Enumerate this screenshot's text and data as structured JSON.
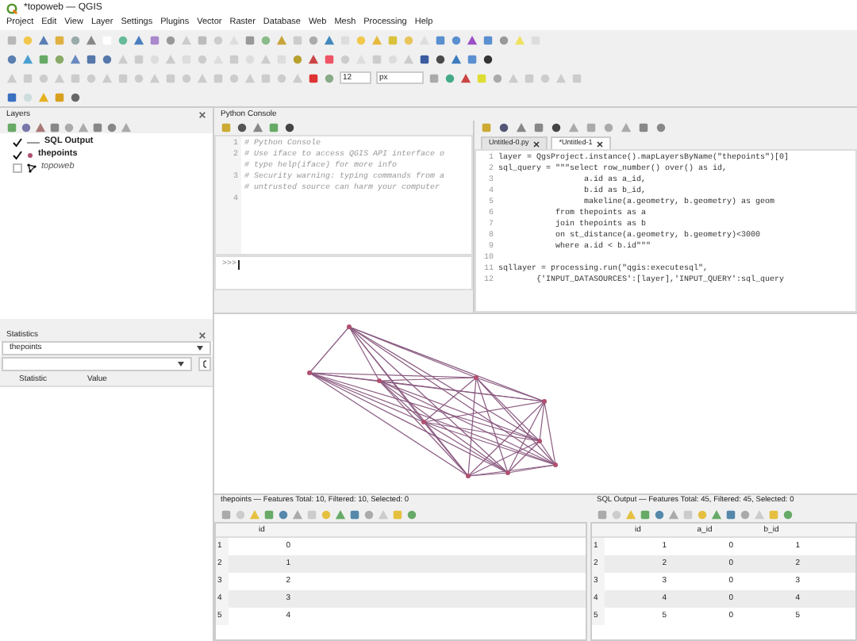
{
  "window": {
    "title": "*topoweb — QGIS"
  },
  "menu": [
    "Project",
    "Edit",
    "View",
    "Layer",
    "Settings",
    "Plugins",
    "Vector",
    "Raster",
    "Database",
    "Web",
    "Mesh",
    "Processing",
    "Help"
  ],
  "toolbar": {
    "font_size": "12",
    "unit": "px"
  },
  "layers_panel": {
    "title": "Layers",
    "items": [
      {
        "label": "SQL Output",
        "kind": "line",
        "checked": true
      },
      {
        "label": "thepoints",
        "kind": "point",
        "checked": true
      },
      {
        "label": "topoweb",
        "kind": "mesh",
        "checked": false
      }
    ]
  },
  "python_console": {
    "title": "Python Console",
    "lines": [
      {
        "number": "1",
        "text": "# Python Console"
      },
      {
        "number": "2",
        "text": "# Use iface to access QGIS API interface o"
      },
      {
        "text": "# type help(iface) for more info"
      },
      {
        "number": "3",
        "text": "# Security warning: typing commands from a"
      },
      {
        "text": "# untrusted source can harm your computer"
      },
      {
        "number": "4"
      }
    ],
    "prompt": ">>>",
    "editor_tabs": [
      {
        "label": "Untitled-0.py",
        "selected": false
      },
      {
        "label": "*Untitled-1",
        "selected": true
      }
    ],
    "code": [
      {
        "number": "1",
        "text": "layer = QgsProject.instance().mapLayersByName(\"thepoints\")[0]"
      },
      {
        "number": "2",
        "text": "sql_query = \"\"\"select row_number() over() as id,"
      },
      {
        "number": "3",
        "text": "                  a.id as a_id,"
      },
      {
        "number": "4",
        "text": "                  b.id as b_id,"
      },
      {
        "number": "5",
        "text": "                  makeline(a.geometry, b.geometry) as geom"
      },
      {
        "number": "6",
        "text": "            from thepoints as a"
      },
      {
        "number": "7",
        "text": "            join thepoints as b"
      },
      {
        "number": "8",
        "text": "            on st_distance(a.geometry, b.geometry)<3000"
      },
      {
        "number": "9",
        "text": "            where a.id < b.id\"\"\""
      },
      {
        "number": "10"
      },
      {
        "number": "11",
        "text": "sqllayer = processing.run(\"qgis:executesql\","
      },
      {
        "number": "12",
        "text": "        {'INPUT_DATASOURCES':[layer],'INPUT_QUERY':sql_query"
      }
    ]
  },
  "statistics_panel": {
    "title": "Statistics",
    "layer": "thepoints",
    "columns": [
      "Statistic",
      "Value"
    ]
  },
  "attribute_tables": [
    {
      "title": "thepoints — Features Total: 10, Filtered: 10, Selected: 0",
      "columns": [
        "id"
      ],
      "rows": [
        {
          "number": "1",
          "cells": [
            "0"
          ]
        },
        {
          "number": "2",
          "cells": [
            "1"
          ]
        },
        {
          "number": "3",
          "cells": [
            "2"
          ]
        },
        {
          "number": "4",
          "cells": [
            "3"
          ]
        },
        {
          "number": "5",
          "cells": [
            "4"
          ]
        }
      ]
    },
    {
      "title": "SQL Output — Features Total: 45, Filtered: 45, Selected: 0",
      "columns": [
        "id",
        "a_id",
        "b_id"
      ],
      "rows": [
        {
          "number": "1",
          "cells": [
            "1",
            "0",
            "1"
          ]
        },
        {
          "number": "2",
          "cells": [
            "2",
            "0",
            "2"
          ]
        },
        {
          "number": "3",
          "cells": [
            "3",
            "0",
            "3"
          ]
        },
        {
          "number": "4",
          "cells": [
            "4",
            "0",
            "4"
          ]
        },
        {
          "number": "5",
          "cells": [
            "5",
            "0",
            "5"
          ]
        }
      ]
    }
  ]
}
